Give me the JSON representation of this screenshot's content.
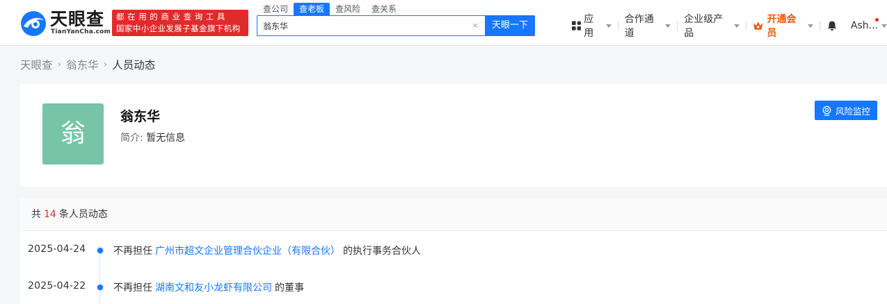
{
  "header": {
    "logo_cn": "天眼查",
    "logo_en": "TianYanCha.com",
    "slogan_line1": "都在用的商业查询工具",
    "slogan_line2": "国家中小企业发展子基金旗下机构",
    "search_tabs": [
      {
        "label": "查公司",
        "active": false
      },
      {
        "label": "查老板",
        "active": true
      },
      {
        "label": "查风险",
        "active": false
      },
      {
        "label": "查关系",
        "active": false
      }
    ],
    "search_value": "翁东华",
    "search_button": "天眼一下",
    "clear_icon": "×",
    "nav": {
      "apps": "应用",
      "cooperation": "合作通道",
      "enterprise": "企业级产品",
      "vip": "开通会员",
      "user": "Ash..."
    }
  },
  "breadcrumb": {
    "home": "天眼查",
    "person": "翁东华",
    "current": "人员动态",
    "separator": "›"
  },
  "profile": {
    "avatar_char": "翁",
    "name": "翁东华",
    "intro_label": "简介:",
    "intro_value": "暂无信息",
    "monitor_button": "风险监控"
  },
  "dynamics": {
    "prefix": "共",
    "count": "14",
    "suffix": "条人员动态",
    "items": [
      {
        "date": "2025-04-24",
        "pre": "不再担任",
        "company": "广州市超文企业管理合伙企业（有限合伙）",
        "post": "的执行事务合伙人"
      },
      {
        "date": "2025-04-22",
        "pre": "不再担任",
        "company": "湖南文和友小龙虾有限公司",
        "post": "的董事"
      }
    ]
  },
  "colors": {
    "brand_blue": "#1677ff",
    "slogan_red": "#e02b2b",
    "avatar_green": "#77c4a8",
    "vip_orange": "#e8590c"
  }
}
